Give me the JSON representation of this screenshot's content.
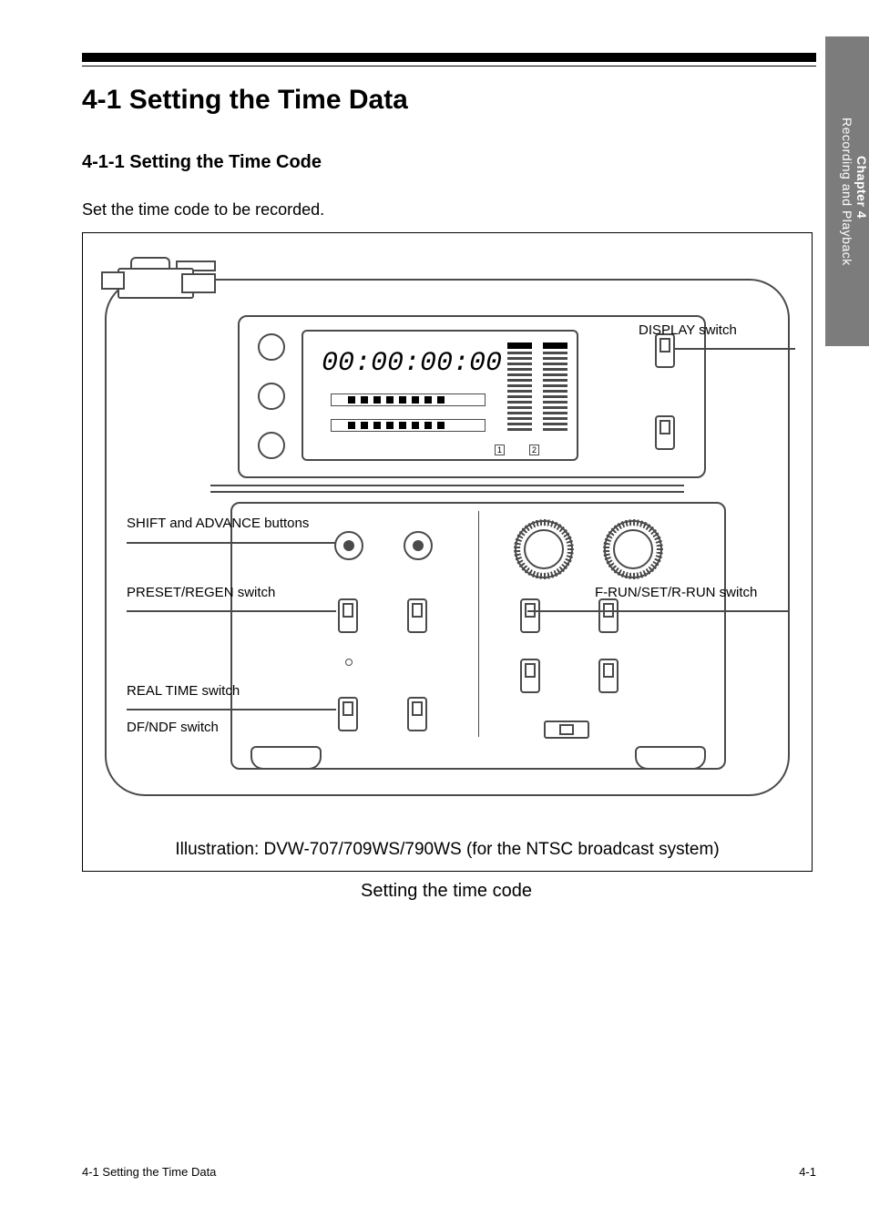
{
  "chapterTab": {
    "num": "Chapter 4",
    "title": "Recording and Playback"
  },
  "sectionNumber": "4-1",
  "sectionTitle": "Setting the Time Data",
  "subsection": "4-1-1  Setting the Time Code",
  "intro": "Set the time code to be recorded.",
  "display": {
    "timecode": "00:00:00:00",
    "ch1": "1",
    "ch2": "2"
  },
  "callouts": {
    "display": "DISPLAY switch",
    "shiftAdvance": "SHIFT and ADVANCE buttons",
    "presetRegen": "PRESET/REGEN switch",
    "frunRrun": "F-RUN/SET/R-RUN switch",
    "realtime": "REAL TIME switch",
    "dfNdf": "DF/NDF switch"
  },
  "figureNote": "Illustration: DVW-707/709WS/790WS (for the NTSC broadcast system)",
  "figureCaption": "Setting the time code",
  "footer": {
    "left": "4-1  Setting the Time Data",
    "right": "4-1"
  }
}
